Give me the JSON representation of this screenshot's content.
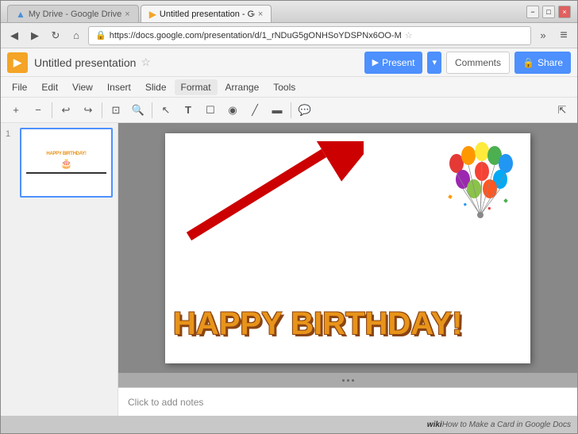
{
  "window": {
    "title": "Untitled presentation - Go",
    "tabs": [
      {
        "label": "My Drive - Google Drive",
        "active": false
      },
      {
        "label": "Untitled presentation - Go",
        "active": true
      }
    ],
    "controls": [
      "minimize",
      "maximize",
      "close"
    ]
  },
  "browser": {
    "back_btn": "◀",
    "forward_btn": "▶",
    "refresh_btn": "↻",
    "home_btn": "⌂",
    "url": "https://docs.google.com/presentation/d/1_rNDuG5gONHSoYDSPNx6OO-M",
    "more_btn": "»",
    "menu_btn": "≡"
  },
  "app": {
    "logo": "▶",
    "title": "Untitled presentation",
    "star_label": "☆",
    "present_label": "Present",
    "present_dropdown": "▾",
    "comments_label": "Comments",
    "share_label": "Share",
    "share_icon": "🔒"
  },
  "menu": {
    "items": [
      "File",
      "Edit",
      "View",
      "Insert",
      "Slide",
      "Format",
      "Arrange",
      "Tools"
    ]
  },
  "toolbar": {
    "buttons": [
      "+",
      "−",
      "↩",
      "↪",
      "⊡",
      "🔍",
      "↖",
      "T",
      "☐",
      "◉",
      "╱",
      "▬"
    ],
    "expand": "⇱"
  },
  "slides": [
    {
      "number": "1"
    }
  ],
  "slide": {
    "happy_birthday": "HAPPY BIRTHDAY!",
    "notes_placeholder": "Click to add notes"
  },
  "footer": {
    "wikihow": "How to Make a Card in Google Docs"
  }
}
